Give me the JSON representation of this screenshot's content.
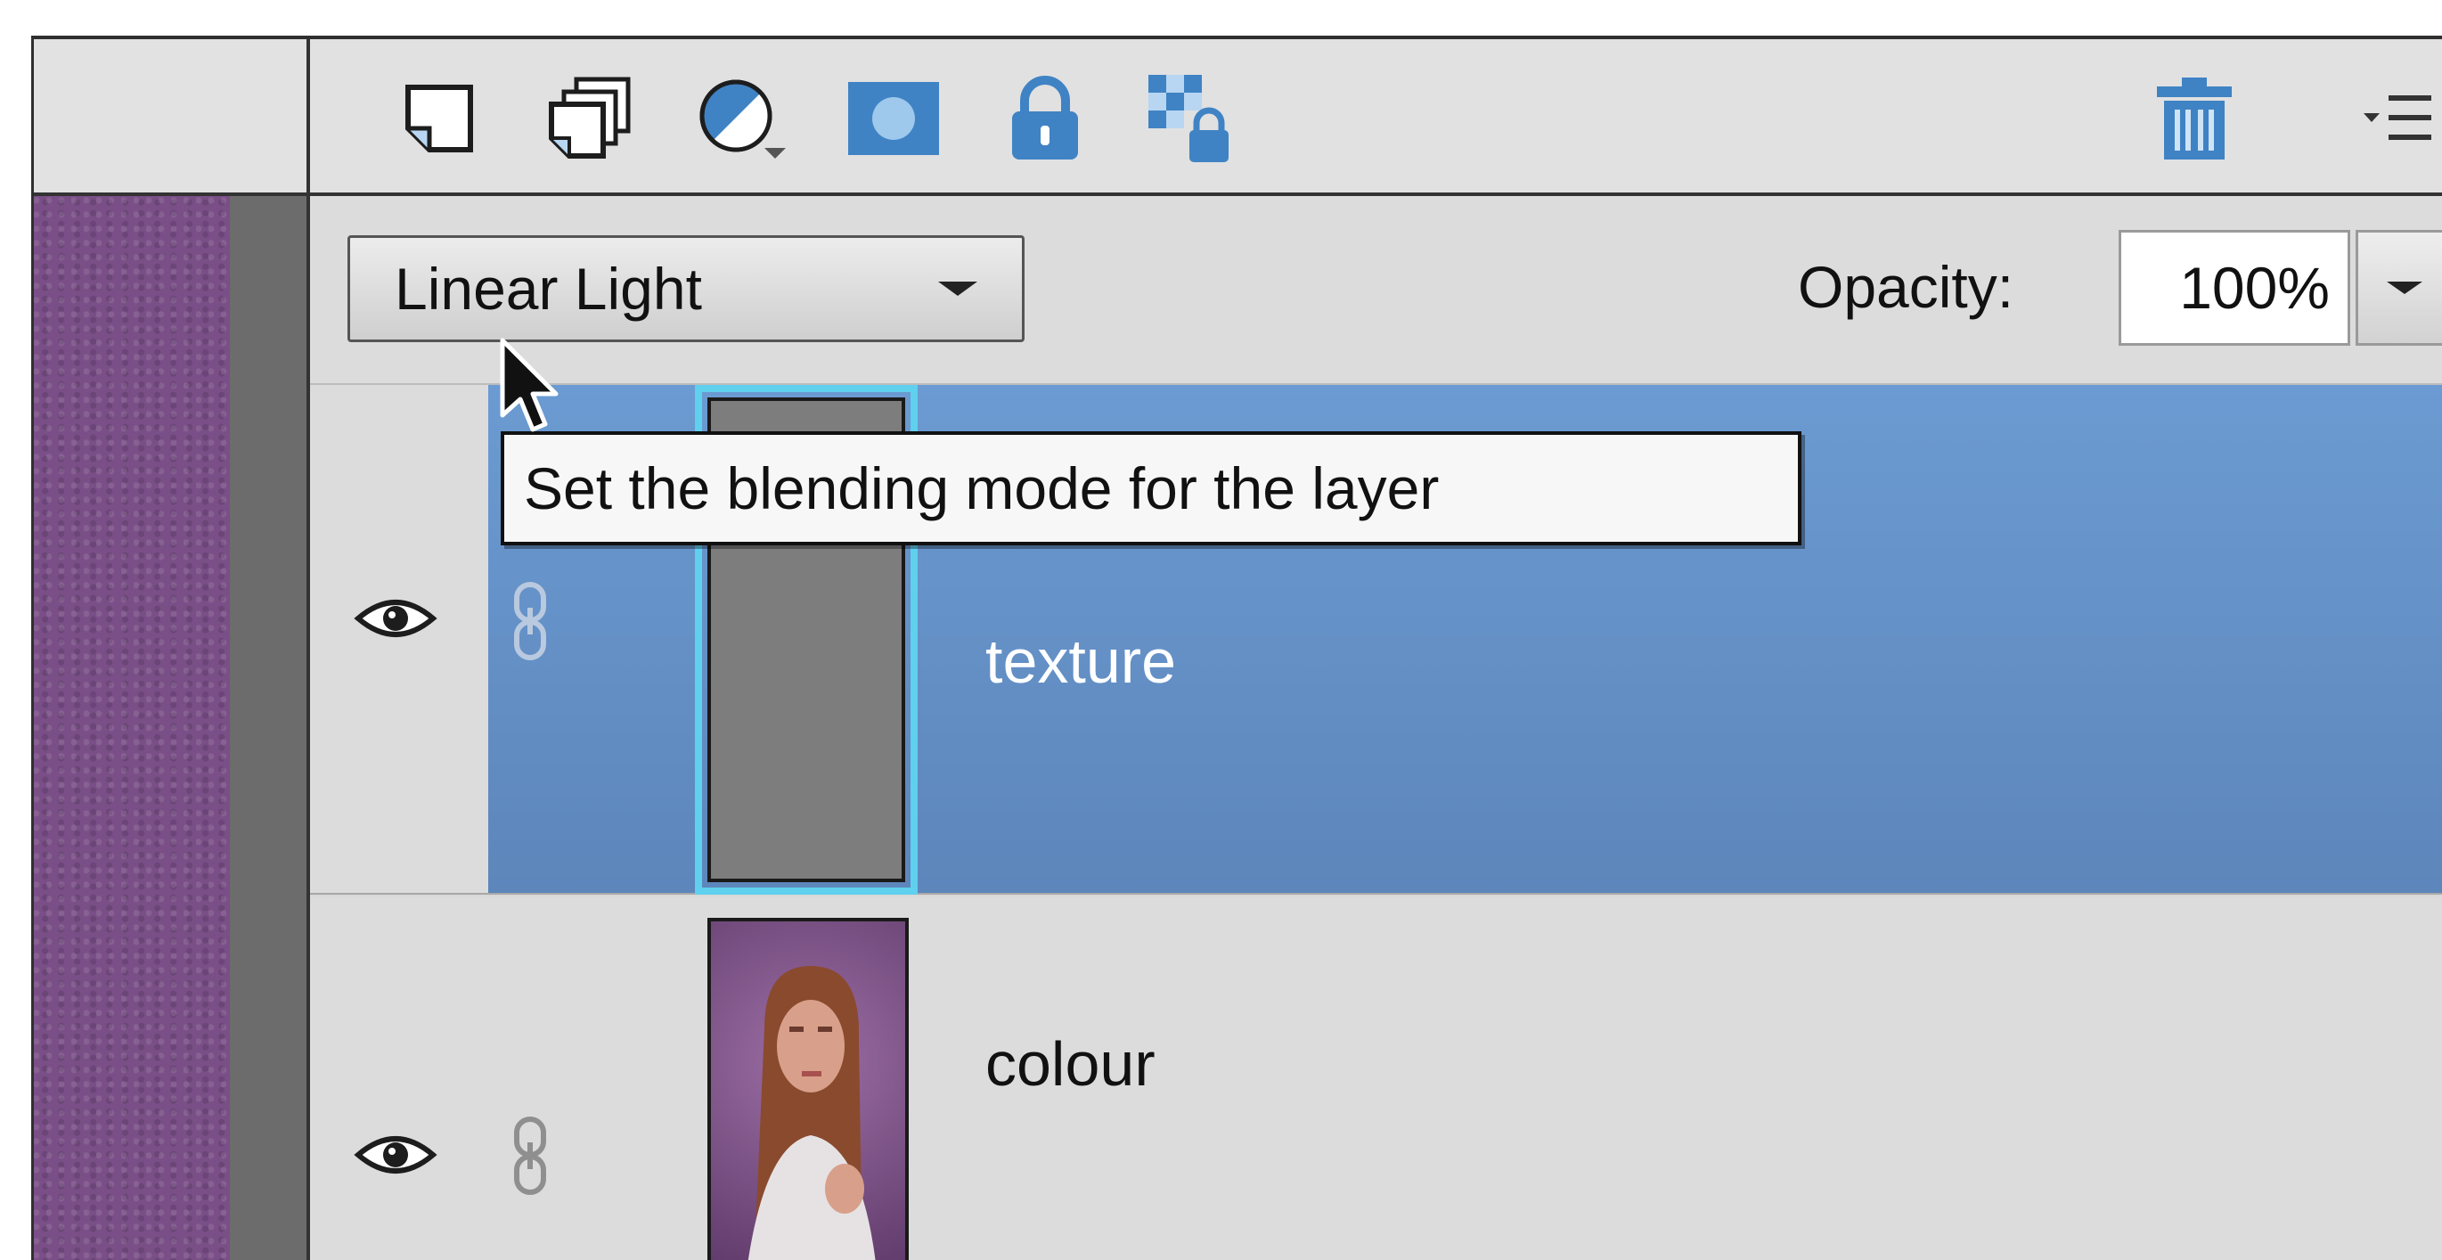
{
  "toolbar": {
    "icons": [
      "new-layer-icon",
      "new-group-icon",
      "adjustment-layer-icon",
      "layer-mask-icon",
      "lock-all-icon",
      "lock-transparency-icon",
      "delete-layer-icon",
      "panel-menu-icon"
    ]
  },
  "blend_mode": {
    "selected": "Linear Light",
    "tooltip": "Set the blending mode for the layer"
  },
  "opacity": {
    "label": "Opacity:",
    "value": "100%"
  },
  "layers": [
    {
      "name": "texture",
      "selected": true,
      "visible": true
    },
    {
      "name": "colour",
      "selected": false,
      "visible": true
    }
  ],
  "colors": {
    "selection": "#6690c6",
    "thumb_border": "#5fd0ee",
    "panel_bg": "#dcdcdd",
    "canvas": "#7a4f87",
    "icon_blue": "#3f83c4"
  }
}
